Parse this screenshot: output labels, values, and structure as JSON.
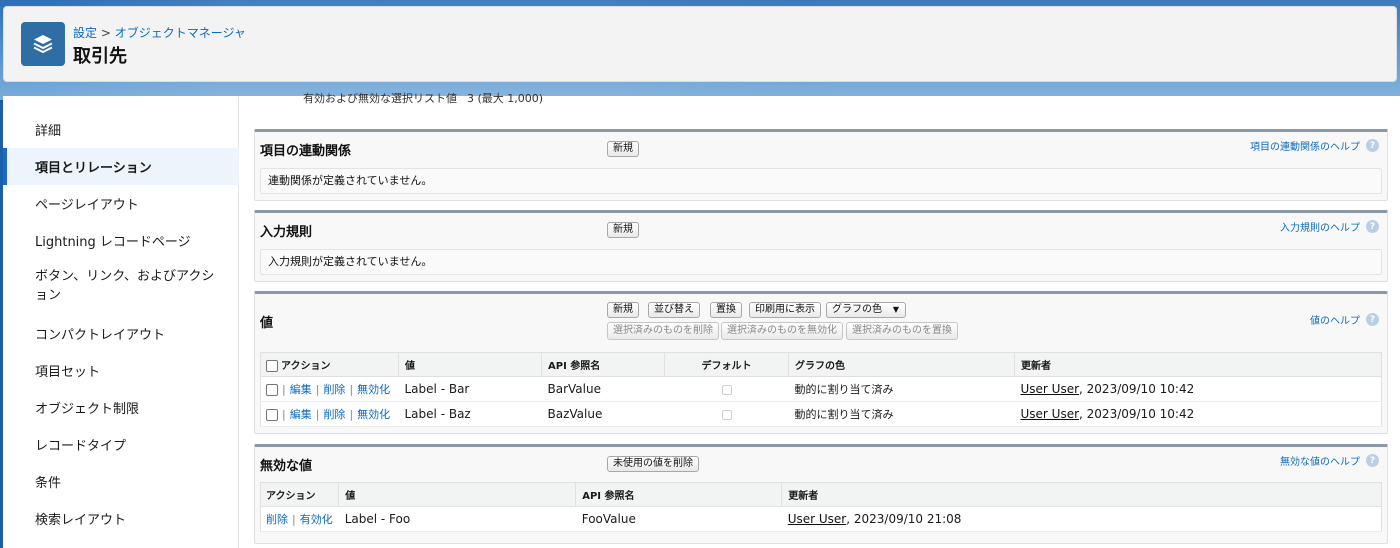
{
  "header": {
    "breadcrumb": {
      "setup": "設定",
      "separator": " > ",
      "object_manager": "オブジェクトマネージャ"
    },
    "title": "取引先",
    "icon": "layers-icon"
  },
  "sidebar": {
    "items": [
      {
        "label": "詳細"
      },
      {
        "label": "項目とリレーション",
        "active": true
      },
      {
        "label": "ページレイアウト"
      },
      {
        "label": "Lightning レコードページ"
      },
      {
        "label": "ボタン、リンク、およびアクション"
      },
      {
        "label": "コンパクトレイアウト"
      },
      {
        "label": "項目セット"
      },
      {
        "label": "オブジェクト制限"
      },
      {
        "label": "レコードタイプ"
      },
      {
        "label": "条件"
      },
      {
        "label": "検索レイアウト"
      }
    ]
  },
  "top_info": {
    "label": "有効および無効な選択リスト値",
    "value": "3 (最大 1,000)"
  },
  "dependencies": {
    "title": "項目の連動関係",
    "new_button": "新規",
    "help": "項目の連動関係のヘルプ",
    "message": "連動関係が定義されていません。"
  },
  "validation": {
    "title": "入力規則",
    "new_button": "新規",
    "help": "入力規則のヘルプ",
    "message": "入力規則が定義されていません。"
  },
  "values": {
    "title": "値",
    "buttons": {
      "new": "新規",
      "reorder": "並び替え",
      "replace": "置換",
      "printable": "印刷用に表示",
      "chart_colors": "グラフの色",
      "delete_selected": "選択済みのものを削除",
      "deactivate_selected": "選択済みのものを無効化",
      "replace_selected": "選択済みのものを置換"
    },
    "help": "値のヘルプ",
    "columns": [
      "アクション",
      "値",
      "API 参照名",
      "デフォルト",
      "グラフの色",
      "更新者"
    ],
    "action_labels": {
      "edit": "編集",
      "delete": "削除",
      "deactivate": "無効化"
    },
    "rows": [
      {
        "value": "Label - Bar",
        "api": "BarValue",
        "chart_color": "動的に割り当て済み",
        "user": "User User",
        "date": ", 2023/09/10 10:42"
      },
      {
        "value": "Label - Baz",
        "api": "BazValue",
        "chart_color": "動的に割り当て済み",
        "user": "User User",
        "date": ", 2023/09/10 10:42"
      }
    ]
  },
  "inactive": {
    "title": "無効な値",
    "delete_unused_button": "未使用の値を削除",
    "help": "無効な値のヘルプ",
    "columns": [
      "アクション",
      "値",
      "API 参照名",
      "更新者"
    ],
    "action_labels": {
      "delete": "削除",
      "activate": "有効化"
    },
    "rows": [
      {
        "value": "Label - Foo",
        "api": "FooValue",
        "user": "User User",
        "date": ", 2023/09/10 21:08"
      }
    ]
  }
}
